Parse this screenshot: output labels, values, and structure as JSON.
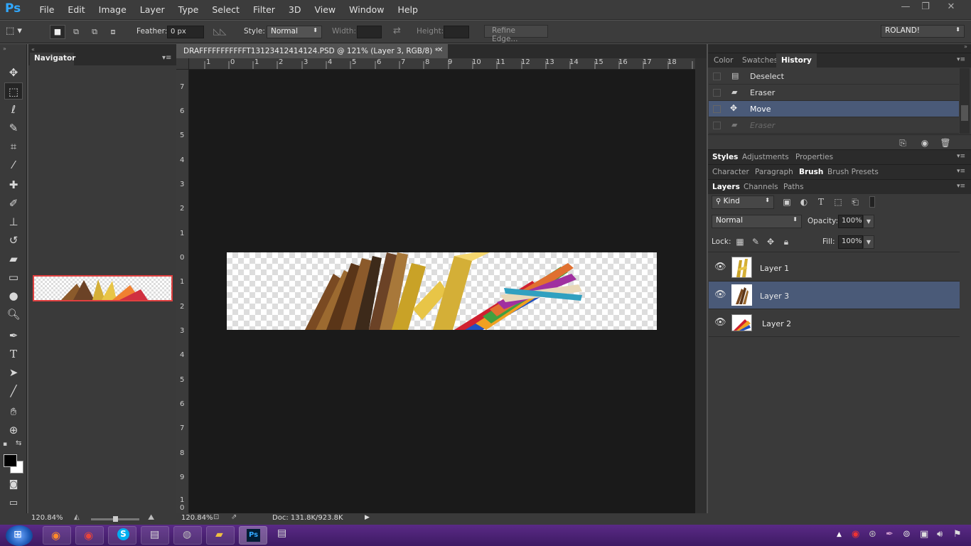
{
  "app": {
    "logo": "Ps"
  },
  "menus": [
    "File",
    "Edit",
    "Image",
    "Layer",
    "Type",
    "Select",
    "Filter",
    "3D",
    "View",
    "Window",
    "Help"
  ],
  "window_controls": {
    "minimize": "—",
    "restore": "❐",
    "close": "✕"
  },
  "options": {
    "feather_label": "Feather:",
    "feather_value": "0 px",
    "style_label": "Style:",
    "style_value": "Normal",
    "width_label": "Width:",
    "height_label": "Height:",
    "refine_label": "Refine Edge...",
    "workspace": "ROLAND!"
  },
  "navigator": {
    "tab": "Navigator",
    "zoom": "120.84%"
  },
  "document": {
    "tab_title": "DRAFFFFFFFFFFFT13123412414124.PSD @ 121% (Layer 3, RGB/8) *",
    "close": "✕",
    "zoom": "120.84%",
    "doc_info": "Doc: 131.8K/923.8K"
  },
  "ruler_top": [
    "1",
    "0",
    "1",
    "2",
    "3",
    "4",
    "5",
    "6",
    "7",
    "8",
    "9",
    "10",
    "11",
    "12",
    "13",
    "14",
    "15",
    "16",
    "17",
    "18"
  ],
  "ruler_left": [
    "7",
    "6",
    "5",
    "4",
    "3",
    "2",
    "1",
    "0",
    "1",
    "2",
    "3",
    "4",
    "5",
    "6",
    "7",
    "8",
    "9",
    "1",
    "0"
  ],
  "panels": {
    "top_tabs": [
      "Color",
      "Swatches",
      "History"
    ],
    "history": [
      {
        "label": "Deselect",
        "icon": "document-icon"
      },
      {
        "label": "Eraser",
        "icon": "eraser-icon"
      },
      {
        "label": "Move",
        "icon": "move-icon",
        "selected": true
      },
      {
        "label": "Eraser",
        "icon": "eraser-icon",
        "dimmed": true
      }
    ],
    "mid_tabs": [
      "Styles",
      "Adjustments",
      "Properties"
    ],
    "char_tabs": [
      "Character",
      "Paragraph",
      "Brush",
      "Brush Presets"
    ],
    "layer_tabs": [
      "Layers",
      "Channels",
      "Paths"
    ],
    "kind_label": "Kind",
    "blend_mode": "Normal",
    "opacity_label": "Opacity:",
    "opacity_value": "100%",
    "lock_label": "Lock:",
    "fill_label": "Fill:",
    "fill_value": "100%",
    "layers": [
      {
        "name": "Layer 1",
        "selected": false
      },
      {
        "name": "Layer 3",
        "selected": true
      },
      {
        "name": "Layer 2",
        "selected": false
      }
    ]
  },
  "colors": {
    "accent": "#31a8ff",
    "selected_row": "#4a5a78",
    "taskbar": "#4b2275"
  }
}
